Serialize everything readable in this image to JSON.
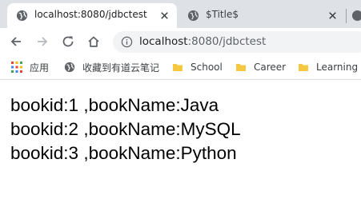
{
  "tabs": [
    {
      "title": "localhost:8080/jdbctest",
      "active": true,
      "icon": "globe-icon"
    },
    {
      "title": "$Title$",
      "active": false,
      "icon": "globe-icon"
    }
  ],
  "toolbar": {
    "url_host": "localhost",
    "url_rest": ":8080/jdbctest"
  },
  "bookmarks": [
    {
      "label": "应用",
      "icon": "apps-grid-icon"
    },
    {
      "label": "收藏到有道云笔记",
      "icon": "globe-icon"
    },
    {
      "label": "School",
      "icon": "folder-icon"
    },
    {
      "label": "Career",
      "icon": "folder-icon"
    },
    {
      "label": "Learning",
      "icon": "folder-icon"
    }
  ],
  "content": {
    "lines": [
      "bookid:1 ,bookName:Java",
      "bookid:2 ,bookName:MySQL",
      "bookid:3 ,bookName:Python"
    ]
  },
  "colors": {
    "tabstrip": "#dee1e6",
    "omnibox": "#f1f3f4",
    "folder": "#f5c842",
    "icon_gray": "#5f6368"
  }
}
